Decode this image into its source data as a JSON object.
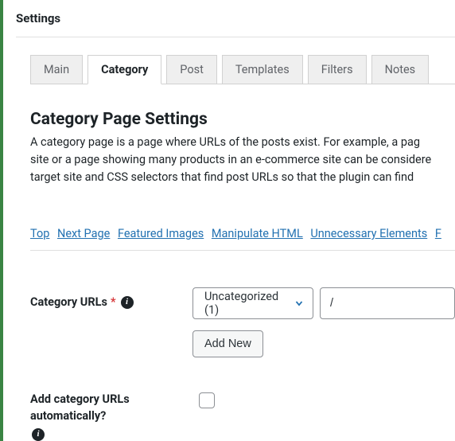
{
  "panel_title": "Settings",
  "tabs": {
    "main": "Main",
    "category": "Category",
    "post": "Post",
    "templates": "Templates",
    "filters": "Filters",
    "notes": "Notes"
  },
  "section": {
    "title": "Category Page Settings",
    "desc_line1": "A category page is a page where URLs of the posts exist. For example, a pag",
    "desc_line2": "site or a page showing many products in an e-commerce site can be considere",
    "desc_line3": "target site and CSS selectors that find post URLs so that the plugin can find"
  },
  "jump_links": {
    "top": "Top",
    "next_page": "Next Page",
    "featured_images": "Featured Images",
    "manipulate_html": "Manipulate HTML",
    "unnecessary_elements": "Unnecessary Elements",
    "more": "F"
  },
  "form": {
    "category_urls_label": "Category URLs",
    "category_urls_asterisk": "*",
    "select_value": "Uncategorized (1)",
    "url_value": "/",
    "add_new_label": "Add New",
    "auto_add_label_l1": "Add category URLs",
    "auto_add_label_l2": "automatically?"
  }
}
